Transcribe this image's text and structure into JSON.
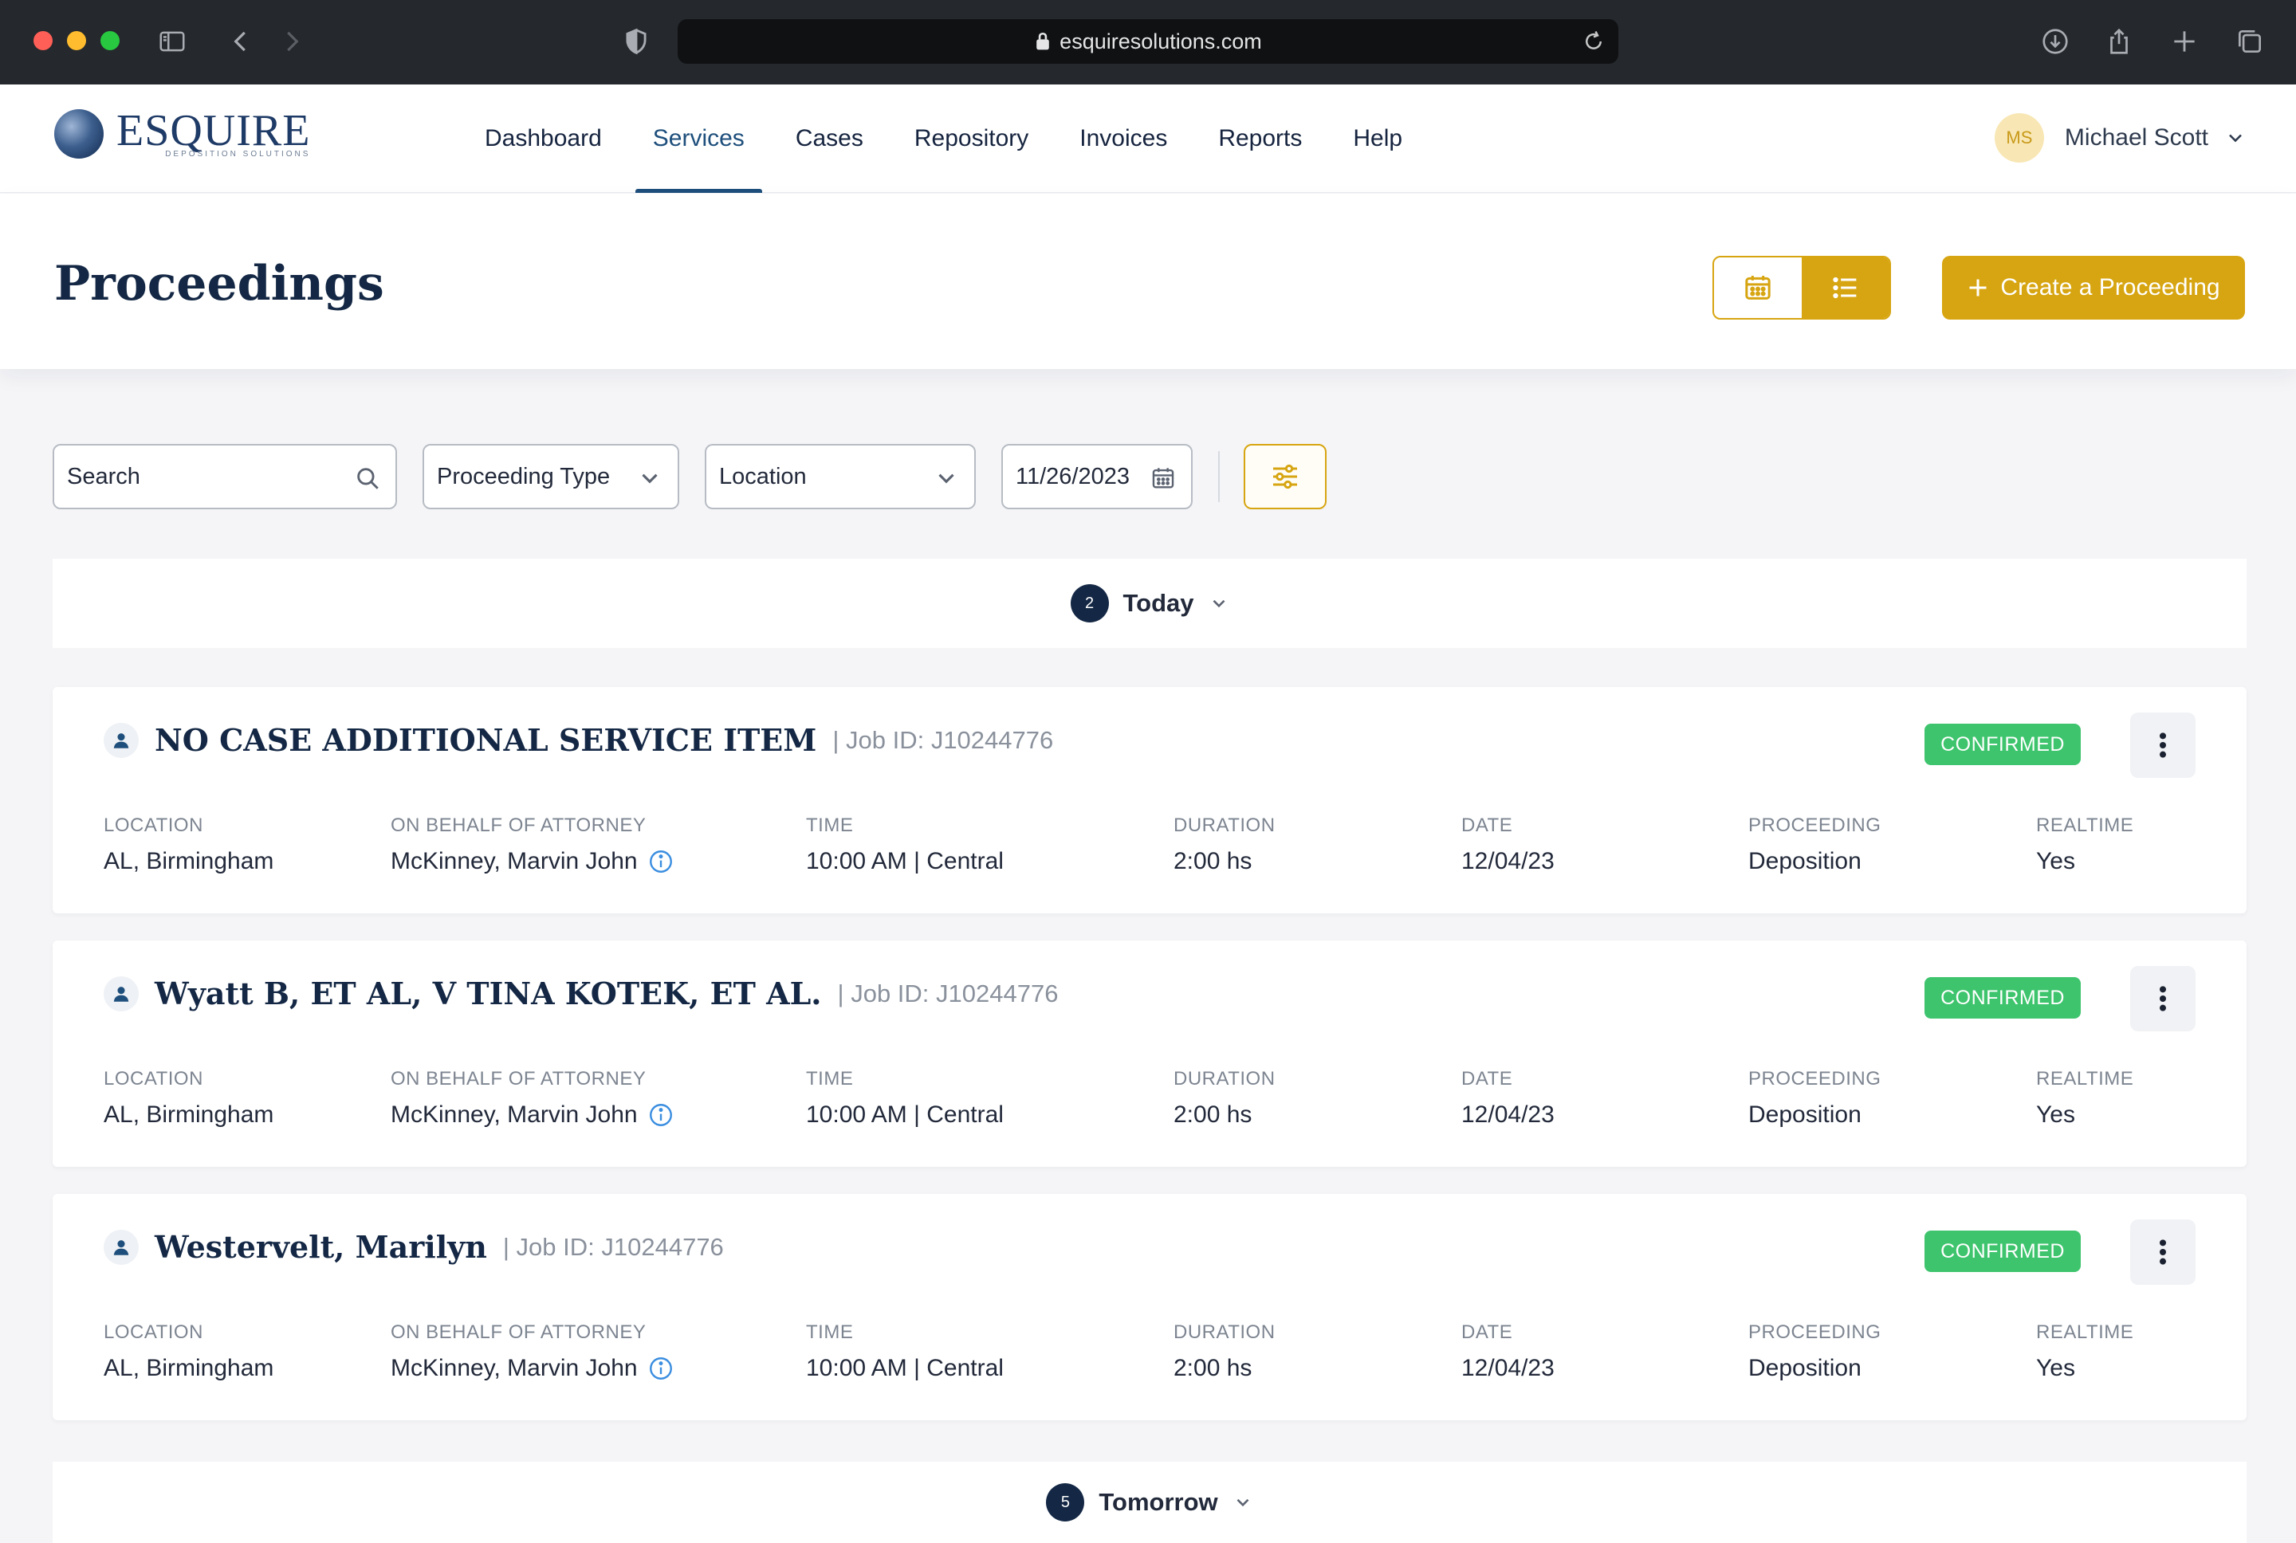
{
  "browser": {
    "url": "esquiresolutions.com"
  },
  "header": {
    "logo_word": "ESQUIRE",
    "logo_sub": "DEPOSITION SOLUTIONS",
    "nav": [
      {
        "label": "Dashboard"
      },
      {
        "label": "Services"
      },
      {
        "label": "Cases"
      },
      {
        "label": "Repository"
      },
      {
        "label": "Invoices"
      },
      {
        "label": "Reports"
      },
      {
        "label": "Help"
      }
    ],
    "active_nav": "Services",
    "user": {
      "initials": "MS",
      "name": "Michael Scott"
    }
  },
  "page": {
    "title": "Proceedings",
    "create_button": "Create a Proceeding"
  },
  "filters": {
    "search_placeholder": "Search",
    "proceeding_type": "Proceeding Type",
    "location": "Location",
    "date": "11/26/2023"
  },
  "groups": [
    {
      "count": "2",
      "label": "Today"
    },
    {
      "count": "5",
      "label": "Tomorrow"
    }
  ],
  "field_labels": {
    "location": "LOCATION",
    "attorney": "ON BEHALF OF ATTORNEY",
    "time": "TIME",
    "duration": "DURATION",
    "date": "DATE",
    "proceeding": "PROCEEDING",
    "realtime": "REALTIME"
  },
  "cards": [
    {
      "title": "NO CASE ADDITIONAL SERVICE ITEM",
      "job": "| Job ID: J10244776",
      "status": "CONFIRMED",
      "location": "AL, Birmingham",
      "attorney": "McKinney, Marvin John",
      "time": "10:00 AM | Central",
      "duration": "2:00 hs",
      "date": "12/04/23",
      "proceeding": "Deposition",
      "realtime": "Yes"
    },
    {
      "title": "Wyatt B, ET AL, V TINA KOTEK, ET AL.",
      "job": "| Job ID: J10244776",
      "status": "CONFIRMED",
      "location": "AL, Birmingham",
      "attorney": "McKinney, Marvin John",
      "time": "10:00 AM | Central",
      "duration": "2:00 hs",
      "date": "12/04/23",
      "proceeding": "Deposition",
      "realtime": "Yes"
    },
    {
      "title": "Westervelt, Marilyn",
      "job": "| Job ID: J10244776",
      "status": "CONFIRMED",
      "location": "AL, Birmingham",
      "attorney": "McKinney, Marvin John",
      "time": "10:00 AM | Central",
      "duration": "2:00 hs",
      "date": "12/04/23",
      "proceeding": "Deposition",
      "realtime": "Yes"
    }
  ],
  "colors": {
    "accent": "#d7a511",
    "navy": "#142845",
    "confirmed": "#3ec46d",
    "nav_active": "#1e4f7c"
  },
  "icons": {
    "sidebar": "sidebar-icon",
    "back": "back-arrow-icon",
    "forward": "forward-arrow-icon",
    "shield": "shield-icon",
    "lock": "lock-icon",
    "reload": "reload-icon",
    "download": "download-icon",
    "share": "share-icon",
    "new_tab": "plus-icon",
    "tabs": "tabs-overview-icon",
    "calendar": "calendar-icon",
    "list": "list-icon",
    "search": "search-icon",
    "filters": "sliders-icon",
    "person": "person-icon",
    "info": "info-icon",
    "more": "kebab-icon"
  }
}
